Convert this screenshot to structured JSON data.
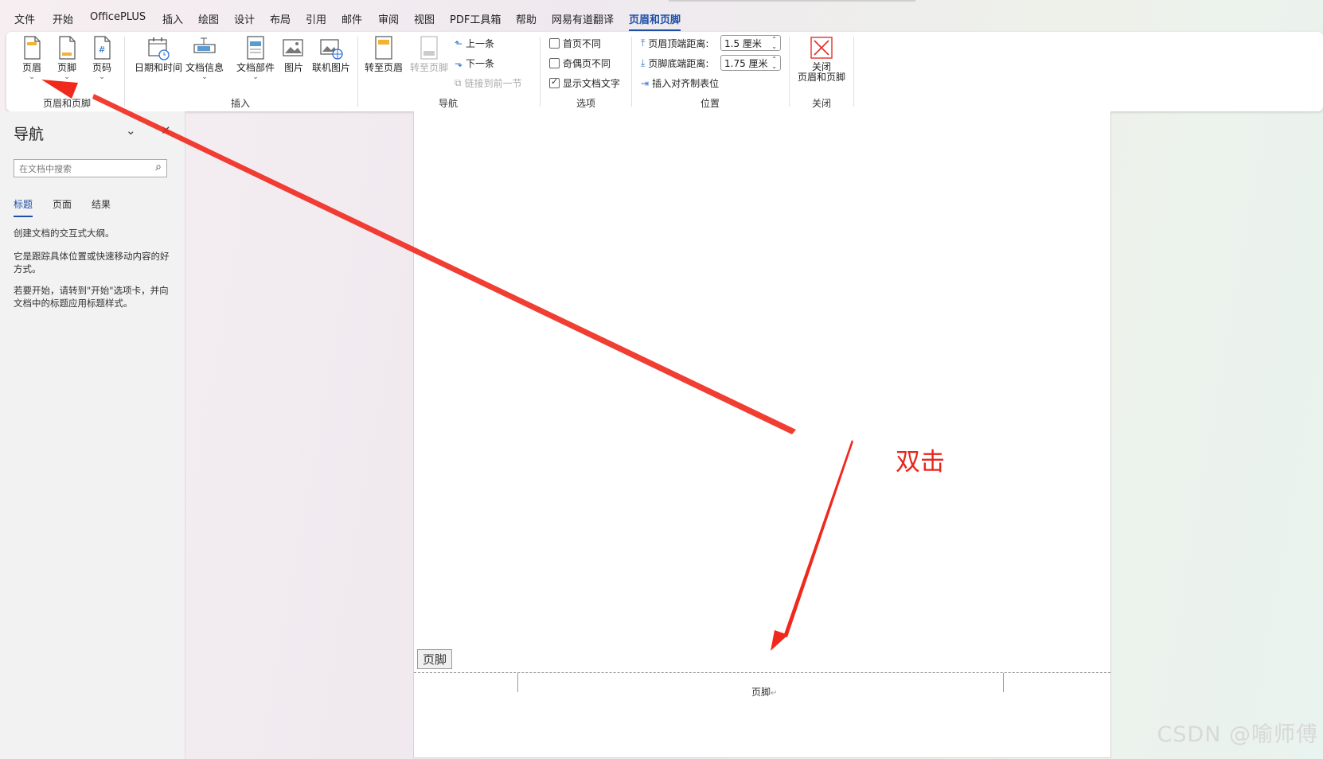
{
  "menu": {
    "tabs": [
      "文件",
      "开始",
      "OfficePLUS",
      "插入",
      "绘图",
      "设计",
      "布局",
      "引用",
      "邮件",
      "审阅",
      "视图",
      "PDF工具箱",
      "帮助",
      "网易有道翻译",
      "页眉和页脚"
    ],
    "active": "页眉和页脚"
  },
  "ribbon": {
    "group_header_footer": {
      "label": "页眉和页脚",
      "header": "页眉",
      "footer": "页脚",
      "page_number": "页码"
    },
    "group_insert": {
      "label": "插入",
      "date_time": "日期和时间",
      "doc_info": "文档信息",
      "doc_parts": "文档部件",
      "picture": "图片",
      "online_picture": "联机图片"
    },
    "group_nav": {
      "label": "导航",
      "goto_header": "转至页眉",
      "goto_footer": "转至页脚",
      "previous": "上一条",
      "next": "下一条",
      "link_previous": "链接到前一节"
    },
    "group_options": {
      "label": "选项",
      "first_page": "首页不同",
      "odd_even": "奇偶页不同",
      "show_doc_text": "显示文档文字",
      "first_page_checked": false,
      "odd_even_checked": false,
      "show_doc_text_checked": true
    },
    "group_position": {
      "label": "位置",
      "header_top_label": "页眉顶端距离:",
      "header_top_value": "1.5 厘米",
      "footer_bottom_label": "页脚底端距离:",
      "footer_bottom_value": "1.75 厘米",
      "insert_align_tab": "插入对齐制表位"
    },
    "group_close": {
      "label": "关闭",
      "close_line1": "关闭",
      "close_line2": "页眉和页脚"
    }
  },
  "nav": {
    "title": "导航",
    "search_placeholder": "在文档中搜索",
    "tabs": [
      "标题",
      "页面",
      "结果"
    ],
    "active_tab": "标题",
    "text1": "创建文档的交互式大纲。",
    "text2": "它是跟踪具体位置或快速移动内容的好方式。",
    "text3": "若要开始，请转到\"开始\"选项卡，并向文档中的标题应用标题样式。"
  },
  "document": {
    "footer_tag": "页脚",
    "footer_text": "页脚",
    "paragraph_mark": "↵"
  },
  "annotation": {
    "text": "双击",
    "color": "#e8261c"
  },
  "watermark": "CSDN @喻师傅",
  "colors": {
    "accent": "#1f4fa8",
    "arrow": "#f0291d"
  }
}
